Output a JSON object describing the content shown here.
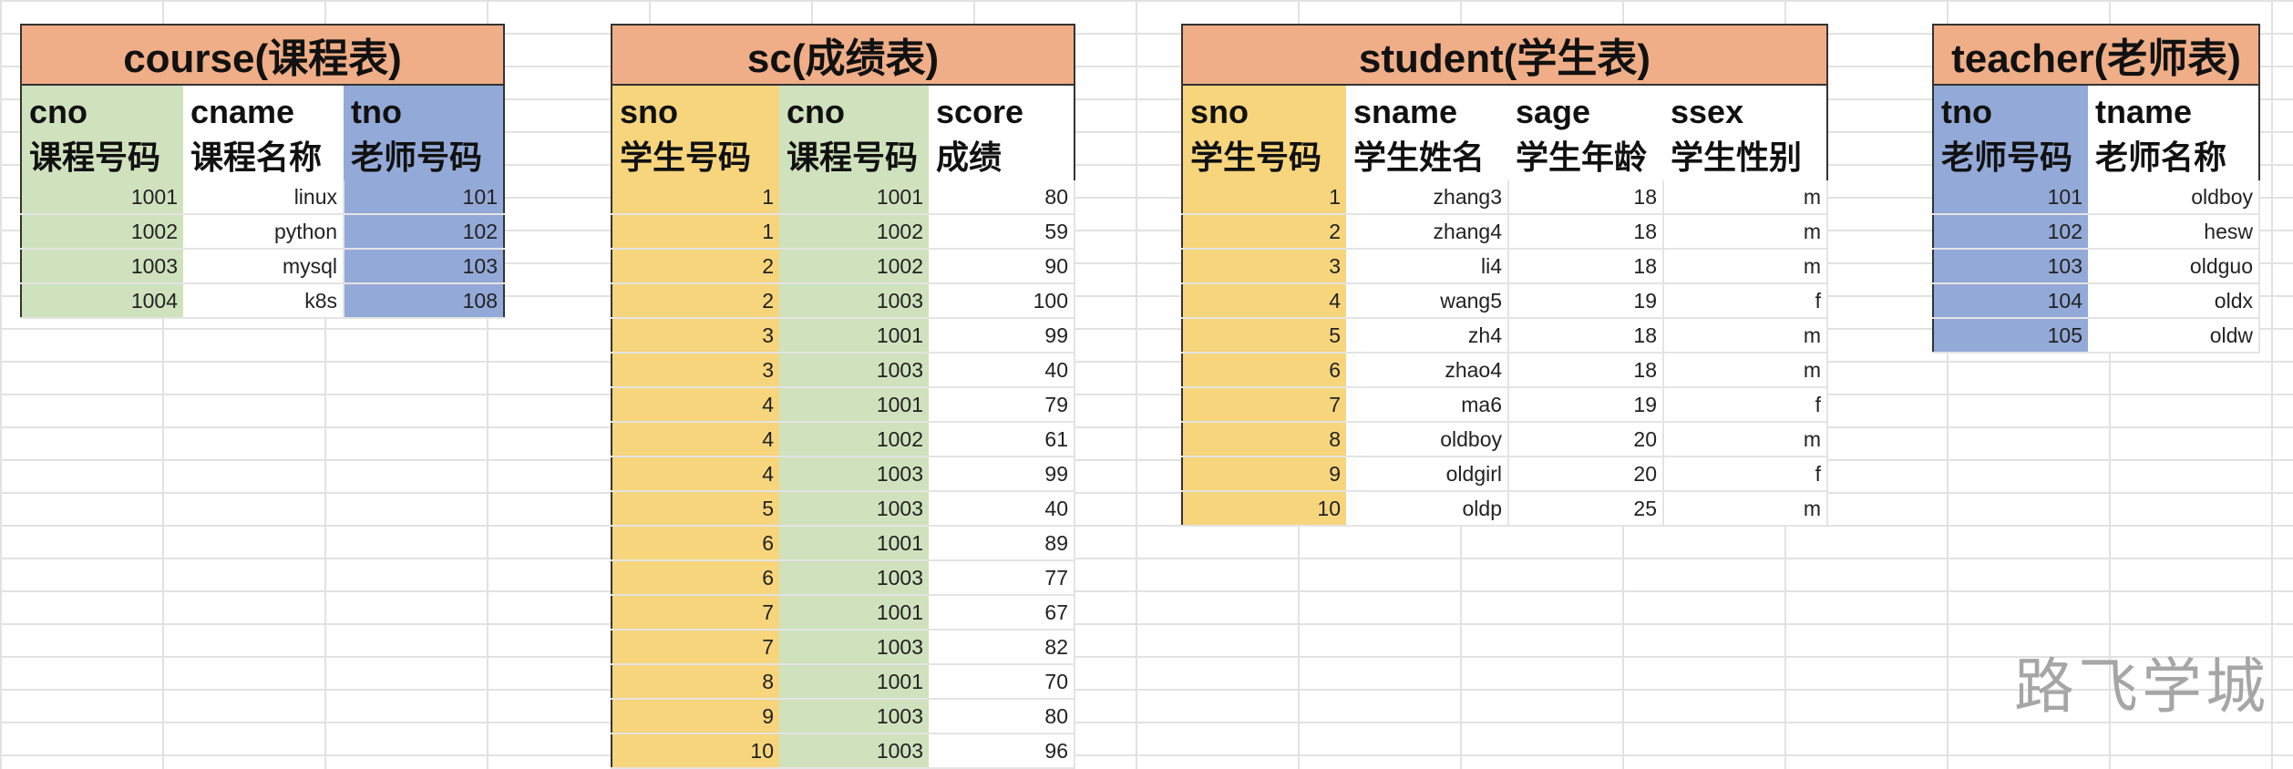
{
  "course": {
    "title": "course(课程表)",
    "headers": [
      {
        "en": "cno",
        "cn": "课程号码"
      },
      {
        "en": "cname",
        "cn": "课程名称"
      },
      {
        "en": "tno",
        "cn": "老师号码"
      }
    ],
    "rows": [
      [
        "1001",
        "linux",
        "101"
      ],
      [
        "1002",
        "python",
        "102"
      ],
      [
        "1003",
        "mysql",
        "103"
      ],
      [
        "1004",
        "k8s",
        "108"
      ]
    ]
  },
  "sc": {
    "title": "sc(成绩表)",
    "headers": [
      {
        "en": "sno",
        "cn": "学生号码"
      },
      {
        "en": "cno",
        "cn": "课程号码"
      },
      {
        "en": "score",
        "cn": "成绩"
      }
    ],
    "rows": [
      [
        "1",
        "1001",
        "80"
      ],
      [
        "1",
        "1002",
        "59"
      ],
      [
        "2",
        "1002",
        "90"
      ],
      [
        "2",
        "1003",
        "100"
      ],
      [
        "3",
        "1001",
        "99"
      ],
      [
        "3",
        "1003",
        "40"
      ],
      [
        "4",
        "1001",
        "79"
      ],
      [
        "4",
        "1002",
        "61"
      ],
      [
        "4",
        "1003",
        "99"
      ],
      [
        "5",
        "1003",
        "40"
      ],
      [
        "6",
        "1001",
        "89"
      ],
      [
        "6",
        "1003",
        "77"
      ],
      [
        "7",
        "1001",
        "67"
      ],
      [
        "7",
        "1003",
        "82"
      ],
      [
        "8",
        "1001",
        "70"
      ],
      [
        "9",
        "1003",
        "80"
      ],
      [
        "10",
        "1003",
        "96"
      ]
    ]
  },
  "student": {
    "title": "student(学生表)",
    "headers": [
      {
        "en": "sno",
        "cn": "学生号码"
      },
      {
        "en": "sname",
        "cn": "学生姓名"
      },
      {
        "en": "sage",
        "cn": "学生年龄"
      },
      {
        "en": "ssex",
        "cn": "学生性别"
      }
    ],
    "rows": [
      [
        "1",
        "zhang3",
        "18",
        "m"
      ],
      [
        "2",
        "zhang4",
        "18",
        "m"
      ],
      [
        "3",
        "li4",
        "18",
        "m"
      ],
      [
        "4",
        "wang5",
        "19",
        "f"
      ],
      [
        "5",
        "zh4",
        "18",
        "m"
      ],
      [
        "6",
        "zhao4",
        "18",
        "m"
      ],
      [
        "7",
        "ma6",
        "19",
        "f"
      ],
      [
        "8",
        "oldboy",
        "20",
        "m"
      ],
      [
        "9",
        "oldgirl",
        "20",
        "f"
      ],
      [
        "10",
        "oldp",
        "25",
        "m"
      ]
    ]
  },
  "teacher": {
    "title": "teacher(老师表)",
    "headers": [
      {
        "en": "tno",
        "cn": "老师号码"
      },
      {
        "en": "tname",
        "cn": "老师名称"
      }
    ],
    "rows": [
      [
        "101",
        "oldboy"
      ],
      [
        "102",
        "hesw"
      ],
      [
        "103",
        "oldguo"
      ],
      [
        "104",
        "oldx"
      ],
      [
        "105",
        "oldw"
      ]
    ]
  },
  "watermark": "路飞学城",
  "colors": {
    "title_bg": "#efae87",
    "green": "#cfe2bd",
    "yellow": "#f7d57c",
    "blue": "#93a9d8"
  }
}
